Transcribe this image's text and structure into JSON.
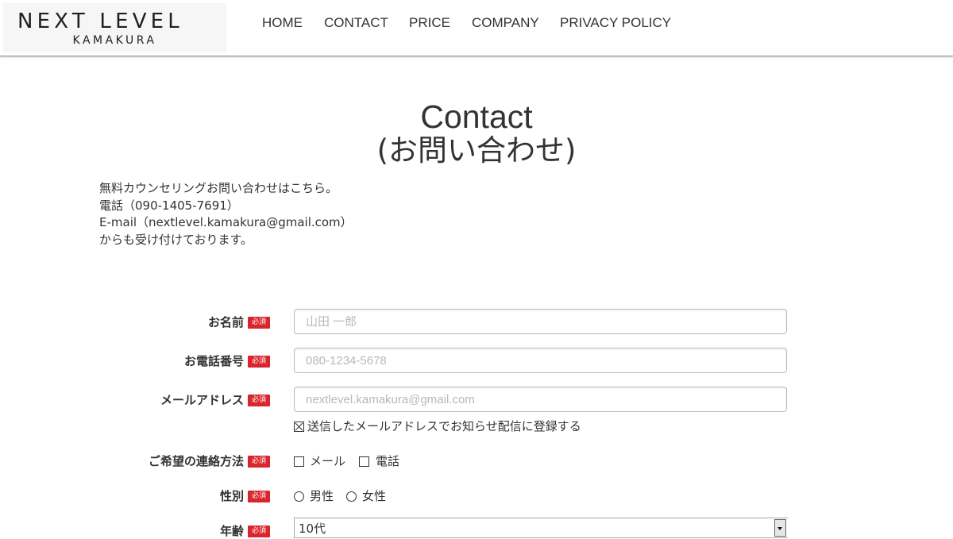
{
  "header": {
    "logo_main": "NEXT LEVEL",
    "logo_sub": "KAMAKURA",
    "nav": [
      "HOME",
      "CONTACT",
      "PRICE",
      "COMPANY",
      "PRIVACY POLICY"
    ]
  },
  "page": {
    "title": "Contact",
    "subtitle": "(お問い合わせ)"
  },
  "intro": [
    "無料カウンセリングお問い合わせはこちら。",
    "電話（090-1405-7691）",
    "E-mail（nextlevel.kamakura@gmail.com）",
    "からも受け付けております。"
  ],
  "form": {
    "required_badge": "必須",
    "name": {
      "label": "お名前",
      "placeholder": "山田 一郎"
    },
    "phone": {
      "label": "お電話番号",
      "placeholder": "080-1234-5678"
    },
    "email": {
      "label": "メールアドレス",
      "placeholder": "nextlevel.kamakura@gmail.com",
      "subscribe_label": "送信したメールアドレスでお知らせ配信に登録する",
      "subscribe_checked": true
    },
    "contact_method": {
      "label": "ご希望の連絡方法",
      "options": [
        "メール",
        "電話"
      ]
    },
    "gender": {
      "label": "性別",
      "options": [
        "男性",
        "女性"
      ]
    },
    "age": {
      "label": "年齢",
      "selected": "10代"
    }
  },
  "colors": {
    "required_badge": "#d9262c",
    "text": "#333333",
    "placeholder": "#b8b8b8"
  }
}
